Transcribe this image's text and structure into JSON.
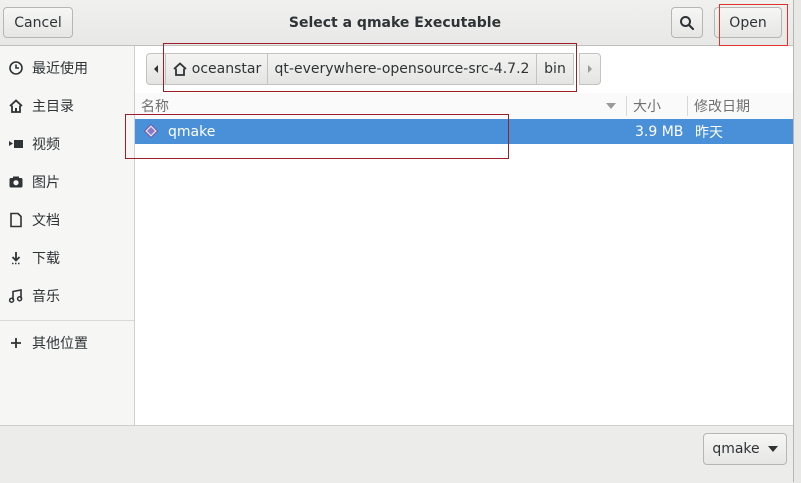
{
  "header": {
    "cancel_label": "Cancel",
    "title": "Select a qmake Executable",
    "open_label": "Open"
  },
  "sidebar": {
    "items": [
      {
        "label": "最近使用",
        "icon": "clock-icon"
      },
      {
        "label": "主目录",
        "icon": "home-icon"
      },
      {
        "label": "视频",
        "icon": "video-icon"
      },
      {
        "label": "图片",
        "icon": "camera-icon"
      },
      {
        "label": "文档",
        "icon": "document-icon"
      },
      {
        "label": "下载",
        "icon": "download-icon"
      },
      {
        "label": "音乐",
        "icon": "music-icon"
      },
      {
        "label": "其他位置",
        "icon": "plus-icon"
      }
    ]
  },
  "pathbar": {
    "home": "oceanstar",
    "segment1": "qt-everywhere-opensource-src-4.7.2",
    "segment2": "bin"
  },
  "columns": {
    "name": "名称",
    "size": "大小",
    "modified": "修改日期"
  },
  "files": [
    {
      "name": "qmake",
      "size": "3.9 MB",
      "modified": "昨天"
    }
  ],
  "footer": {
    "filter_label": "qmake"
  },
  "colors": {
    "selection": "#4a90d9",
    "annotation_red": "#9d1d2a"
  }
}
